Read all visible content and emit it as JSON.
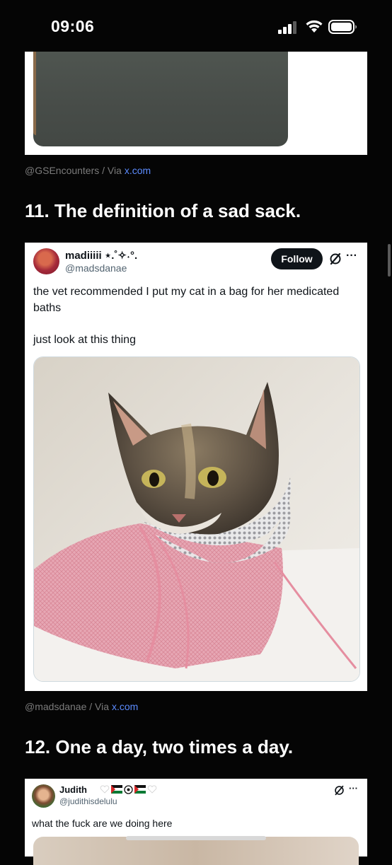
{
  "status_bar": {
    "time": "09:06"
  },
  "prev_item": {
    "credit_handle": "@GSEncounters",
    "credit_sep": " / Via ",
    "credit_site": "x.com"
  },
  "item11": {
    "heading": "11. The definition of a sad sack.",
    "tweet": {
      "name": "madiiiii ⋆.˚✧˖°.",
      "handle": "@madsdanae",
      "follow_label": "Follow",
      "text_line1": "the vet recommended I put my cat in a bag for her medicated baths",
      "text_line2": "just look at this thing",
      "photo_alt": "cat in mesh bath bag"
    },
    "credit_handle": "@madsdanae",
    "credit_sep": " / Via ",
    "credit_site": "x.com"
  },
  "item12": {
    "heading": "12. One a day, two times a day.",
    "tweet": {
      "name": "Judith",
      "handle": "@judithisdelulu",
      "text": "what the fuck are we doing here"
    }
  },
  "icons": [
    "signal-icon",
    "wifi-icon",
    "battery-icon",
    "grok-icon",
    "more-icon",
    "heart-icon",
    "flag-icon"
  ],
  "colors": {
    "background": "#050505",
    "link": "#5c8cff",
    "follow_button": "#0f1419"
  }
}
